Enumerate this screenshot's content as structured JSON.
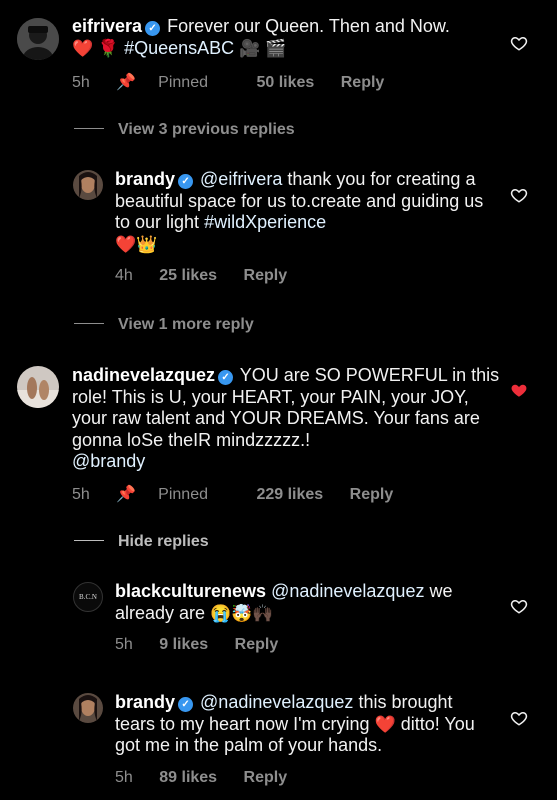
{
  "comments": [
    {
      "username": "eifrivera",
      "text_before": "Forever our Queen. Then and Now.",
      "emoji_line": "❤️ 🌹",
      "hashtag": "#QueensABC",
      "emoji_tail": "🎥 🎬",
      "time": "5h",
      "pinned": "Pinned",
      "likes": "50 likes",
      "reply": "Reply"
    },
    {
      "thread": "View 3 previous replies"
    },
    {
      "username": "brandy",
      "mention": "@eifrivera",
      "text": "thank you for creating a beautiful space for us to.create and guiding us to our light",
      "hashtag": "#wildXperience",
      "emoji": "❤️👑",
      "time": "4h",
      "likes": "25 likes",
      "reply": "Reply"
    },
    {
      "thread": "View 1 more reply"
    },
    {
      "username": "nadinevelazquez",
      "text": "YOU are SO POWERFUL in this role! This is U, your HEART, your PAIN, your JOY, your raw talent and YOUR DREAMS. Your fans are gonna loSe theIR mindzzzzz.!",
      "mention": "@brandy",
      "time": "5h",
      "pinned": "Pinned",
      "likes": "229 likes",
      "reply": "Reply"
    },
    {
      "thread": "Hide replies"
    },
    {
      "username": "blackculturenews",
      "avatar_text": "B.C.N",
      "mention": "@nadinevelazquez",
      "text": "we already are",
      "emoji": "😭🤯🙌🏿",
      "time": "5h",
      "likes": "9 likes",
      "reply": "Reply"
    },
    {
      "username": "brandy",
      "mention": "@nadinevelazquez",
      "text_before": "this brought tears to my heart now I'm crying",
      "emoji": "❤️",
      "text_after": "ditto! You got me in the palm of your hands.",
      "time": "5h",
      "likes": "89 likes",
      "reply": "Reply"
    }
  ],
  "colors": {
    "verified": "#3897f0",
    "liked_heart": "#ed2e3a",
    "meta": "#8e8e8e"
  }
}
